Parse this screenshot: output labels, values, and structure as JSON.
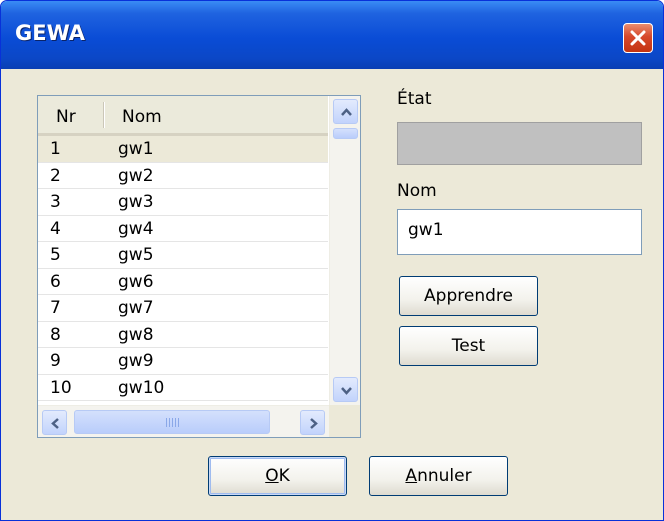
{
  "window": {
    "title": "GEWA"
  },
  "list": {
    "columns": [
      "Nr",
      "Nom"
    ],
    "rows": [
      {
        "nr": "1",
        "nom": "gw1"
      },
      {
        "nr": "2",
        "nom": "gw2"
      },
      {
        "nr": "3",
        "nom": "gw3"
      },
      {
        "nr": "4",
        "nom": "gw4"
      },
      {
        "nr": "5",
        "nom": "gw5"
      },
      {
        "nr": "6",
        "nom": "gw6"
      },
      {
        "nr": "7",
        "nom": "gw7"
      },
      {
        "nr": "8",
        "nom": "gw8"
      },
      {
        "nr": "9",
        "nom": "gw9"
      },
      {
        "nr": "10",
        "nom": "gw10"
      }
    ],
    "selected_row": 0
  },
  "state": {
    "label": "État",
    "value": ""
  },
  "name": {
    "label": "Nom",
    "value": "gw1"
  },
  "buttons": {
    "learn": "Apprendre",
    "test": "Test",
    "ok_mnemonic": "O",
    "ok_rest": "K",
    "cancel_mnemonic": "A",
    "cancel_rest": "nnuler"
  },
  "icons": {
    "close": "close-icon",
    "scroll_up": "arrow-up-icon",
    "scroll_down": "arrow-down-icon",
    "scroll_left": "arrow-left-icon",
    "scroll_right": "arrow-right-icon"
  }
}
